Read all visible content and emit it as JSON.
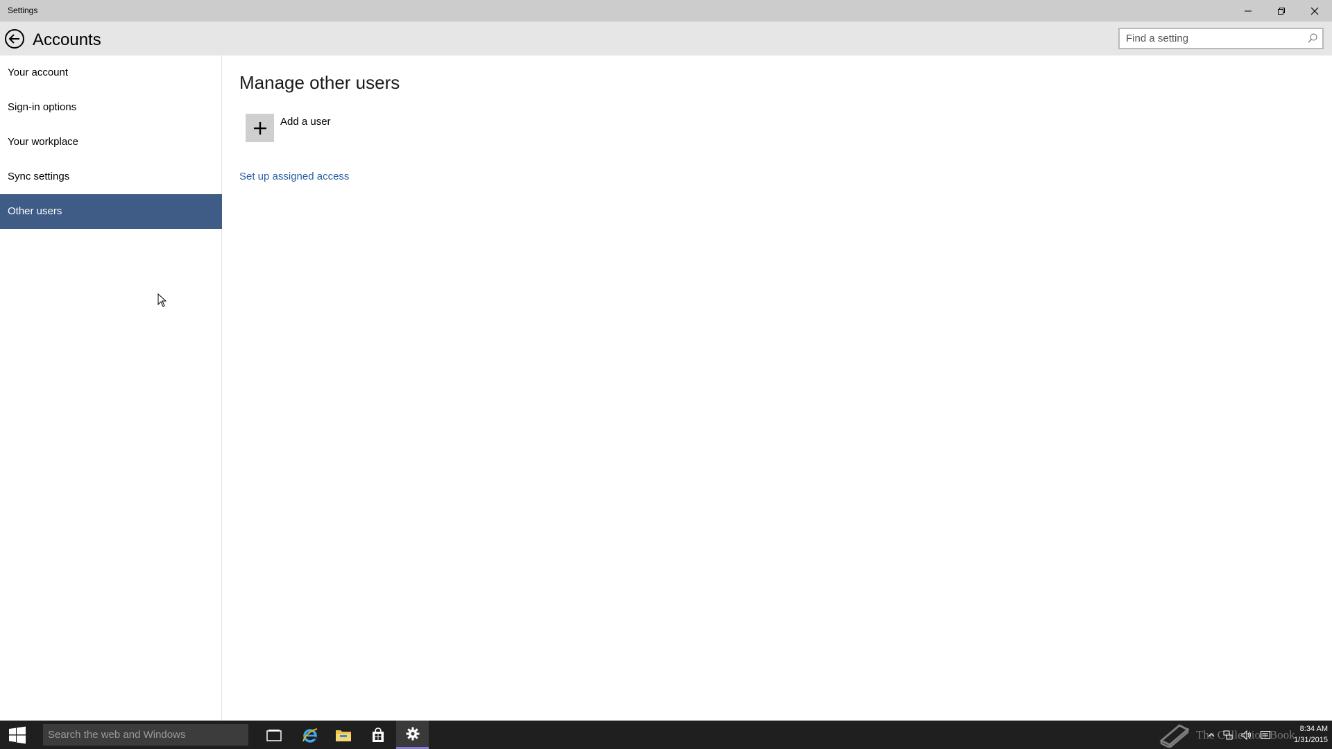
{
  "window": {
    "title": "Settings",
    "controls": {
      "minimize_icon": "minimize-icon",
      "maximize_icon": "restore-icon",
      "close_icon": "close-icon"
    }
  },
  "header": {
    "back_icon": "back-arrow-icon",
    "title": "Accounts",
    "search_placeholder": "Find a setting"
  },
  "sidebar": {
    "items": [
      {
        "label": "Your account",
        "selected": false
      },
      {
        "label": "Sign-in options",
        "selected": false
      },
      {
        "label": "Your workplace",
        "selected": false
      },
      {
        "label": "Sync settings",
        "selected": false
      },
      {
        "label": "Other users",
        "selected": true
      }
    ]
  },
  "main": {
    "section_title": "Manage other users",
    "add_user_label": "Add a user",
    "assigned_access_link": "Set up assigned access"
  },
  "taskbar": {
    "search_placeholder": "Search the web and Windows",
    "apps": [
      "task-view-icon",
      "internet-explorer-icon",
      "file-explorer-icon",
      "store-icon",
      "settings-icon"
    ],
    "watermark_text": "The Collection Book",
    "clock_time": "8:34 AM",
    "clock_date": "1/31/2015"
  },
  "colors": {
    "accent": "#3f5c87",
    "titlebar": "#cccccc",
    "header": "#e6e6e6",
    "link": "#2a5fa5",
    "taskbar": "#1f1f1f"
  }
}
